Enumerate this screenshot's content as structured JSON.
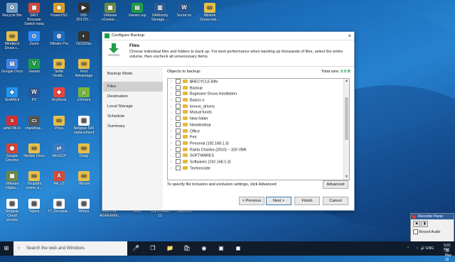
{
  "desktop": {
    "icons": [
      {
        "label": "Recycle Bin",
        "color": "#7aa2c8",
        "glyph": "♻"
      },
      {
        "label": "SRIT Brocade Switch insta",
        "color": "#d94a38",
        "glyph": "▣"
      },
      {
        "label": "PowerISO",
        "color": "#e0a020",
        "glyph": "◉"
      },
      {
        "label": "VID-201707...",
        "color": "#333",
        "glyph": "▶"
      },
      {
        "label": "VMware vCenter ...",
        "color": "#6d8e3f",
        "glyph": "▦"
      },
      {
        "label": "Veeam rep",
        "color": "#1e9e47",
        "glyph": "▤"
      },
      {
        "label": "SANtricity Storage ...",
        "color": "#2a5d9a",
        "glyph": "▥"
      },
      {
        "label": "Serial no",
        "color": "#2b5797",
        "glyph": "W"
      },
      {
        "label": "Minitek Druva inst...",
        "color": "#e6c04a",
        "glyph": "▭"
      },
      {
        "label": "Mindteck Druva i...",
        "color": "#e6c04a",
        "glyph": "▭"
      },
      {
        "label": "Zoom",
        "color": "#2d8cff",
        "glyph": "◎"
      },
      {
        "label": "Ofinder Pro",
        "color": "#1d6fc1",
        "glyph": "◍"
      },
      {
        "label": "ISO2Disc",
        "color": "#333",
        "glyph": "◐"
      },
      {
        "label": "Google Docs",
        "color": "#4285f4",
        "glyph": "▤"
      },
      {
        "label": "Veeam",
        "color": "#1e9e47",
        "glyph": "V"
      },
      {
        "label": "Softe Deskt...",
        "color": "#e6c04a",
        "glyph": "▭"
      },
      {
        "label": "First Advantage",
        "color": "#e6c04a",
        "glyph": "▭"
      },
      {
        "label": "SHAREit",
        "color": "#2196f3",
        "glyph": "◈"
      },
      {
        "label": "P2",
        "color": "#2b5797",
        "glyph": "W"
      },
      {
        "label": "AnyDesk",
        "color": "#ef443b",
        "glyph": "◆"
      },
      {
        "label": "uTorrent",
        "color": "#78b83a",
        "glyph": "µ"
      },
      {
        "label": "airtel Wi-Fi",
        "color": "#d32f2f",
        "glyph": "a"
      },
      {
        "label": "chandraa...",
        "color": "#555",
        "glyph": "▭"
      },
      {
        "label": "Priya",
        "color": "#e6c04a",
        "glyph": "▭"
      },
      {
        "label": "Netgear 526 replacement",
        "color": "#fff",
        "glyph": "▤"
      },
      {
        "label": "Google Chrome",
        "color": "#db4437",
        "glyph": "◉"
      },
      {
        "label": "Nimble Docs",
        "color": "#e6c04a",
        "glyph": "▭"
      },
      {
        "label": "WinSCP",
        "color": "#3d7cc9",
        "glyph": "⇄"
      },
      {
        "label": "Onap",
        "color": "#e6c04a",
        "glyph": "▭"
      },
      {
        "label": "VMware vSphe...",
        "color": "#6d8e3f",
        "glyph": "▦"
      },
      {
        "label": "Tirupathi rooms a...",
        "color": "#e6c04a",
        "glyph": "▭"
      },
      {
        "label": "AA_v3",
        "color": "#d94a38",
        "glyph": "A"
      },
      {
        "label": "Vibrant",
        "color": "#e6c04a",
        "glyph": "▭"
      },
      {
        "label": "Netgear Cloud access",
        "color": "#fff",
        "glyph": "▤"
      },
      {
        "label": "Tejass",
        "color": "#fff",
        "glyph": "▤"
      },
      {
        "label": "IT_Declarat...",
        "color": "#fff",
        "glyph": "▤"
      },
      {
        "label": "Whats",
        "color": "#fff",
        "glyph": "▤"
      },
      {
        "label": "RENTAL AGREEME...",
        "color": "#2b5797",
        "glyph": "W"
      },
      {
        "label": "Eka",
        "color": "#fff",
        "glyph": "▤"
      },
      {
        "label": "TeamViewer 12",
        "color": "#0e8ee9",
        "glyph": "⇆"
      },
      {
        "label": "Jan2018",
        "color": "#c00",
        "glyph": "▤"
      }
    ]
  },
  "dialog": {
    "title": "Configure Backup",
    "close_glyph": "×",
    "header_name": "Files",
    "header_desc": "Choose individual files and folders to back up. For best performance when backing up thousands of files, select the entire volume, then uncheck all unnecessary items.",
    "nav": [
      "Backup Mode",
      "Files",
      "Destination",
      "Local Storage",
      "Schedule",
      "Summary"
    ],
    "objects_label": "Objects to backup:",
    "total_label": "Total size:",
    "total_value": "0.0 B",
    "folders": [
      "$RECYCLE.BIN",
      "Backup",
      "Bagmane Druva installation",
      "Basics o",
      "lenovo_drivers",
      "Mutual funds",
      "New folder",
      "Newdesktop",
      "Office",
      "Peri",
      "Personal (192.168.1.3)",
      "Rakta Charitra (2010) ~ 320 VBR",
      "SOFTWARES",
      "Softwares (192.168.1.3)",
      "Technociate"
    ],
    "hint": "To specify file inclusion and exclusion settings, click Advanced",
    "buttons": {
      "advanced": "Advanced",
      "previous": "< Previous",
      "next": "Next >",
      "finish": "Finish",
      "cancel": "Cancel"
    }
  },
  "taskbar": {
    "search_placeholder": "Search the web and Windows",
    "time": "5:01 PM",
    "date": "16-Mar-18",
    "lang": "ENG"
  },
  "recorder": {
    "title": "Recorder Panel",
    "checkbox": "Record Audio"
  }
}
